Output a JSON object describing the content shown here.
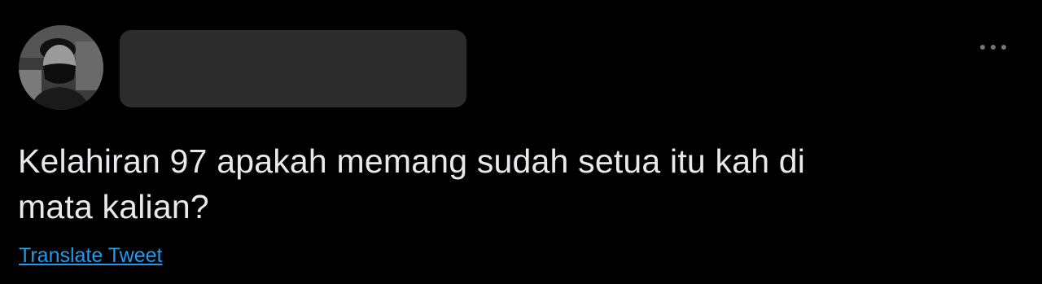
{
  "tweet": {
    "text": "Kelahiran 97 apakah memang sudah setua itu kah di\nmata kalian?",
    "translate_label": "Translate Tweet",
    "more_icon": "more-horizontal-icon"
  },
  "colors": {
    "background": "#000000",
    "text": "#e7e9ea",
    "link": "#1d9bf0",
    "redaction": "#2c2c2c",
    "icon": "#71767b"
  }
}
